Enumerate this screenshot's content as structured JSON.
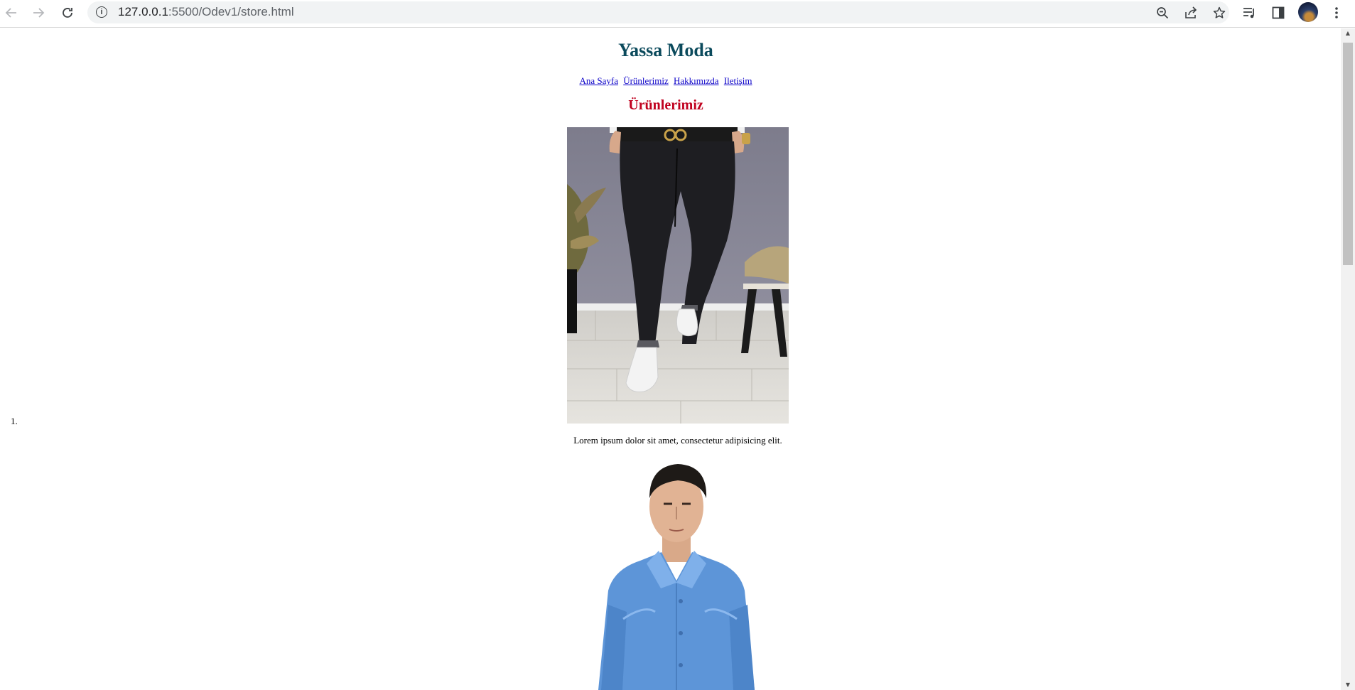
{
  "browser": {
    "url_host": "127.0.0.1",
    "url_path": ":5500/Odev1/store.html",
    "icons": {
      "back": "arrow-left-icon",
      "forward": "arrow-right-icon",
      "reload": "reload-icon",
      "site_info": "info-icon",
      "zoom": "zoom-out-icon",
      "share": "share-icon",
      "bookmark": "star-icon",
      "reading_list": "reading-list-icon",
      "side_panel": "side-panel-icon",
      "menu": "kebab-menu-icon"
    }
  },
  "site": {
    "title": "Yassa Moda",
    "nav": [
      {
        "label": "Ana Sayfa"
      },
      {
        "label": "Ürünlerimiz"
      },
      {
        "label": "Hakkımızda"
      },
      {
        "label": "Iletişim"
      }
    ],
    "section_title": "Ürünlerimiz",
    "colors": {
      "title": "#0b4a5c",
      "section_title": "#c0001e",
      "link": "#0b00c8"
    }
  },
  "products": [
    {
      "marker": "1.",
      "image": "black-trousers-photo",
      "description": "Lorem ipsum dolor sit amet, consectetur adipisicing elit."
    },
    {
      "image": "blue-shirt-photo"
    }
  ]
}
